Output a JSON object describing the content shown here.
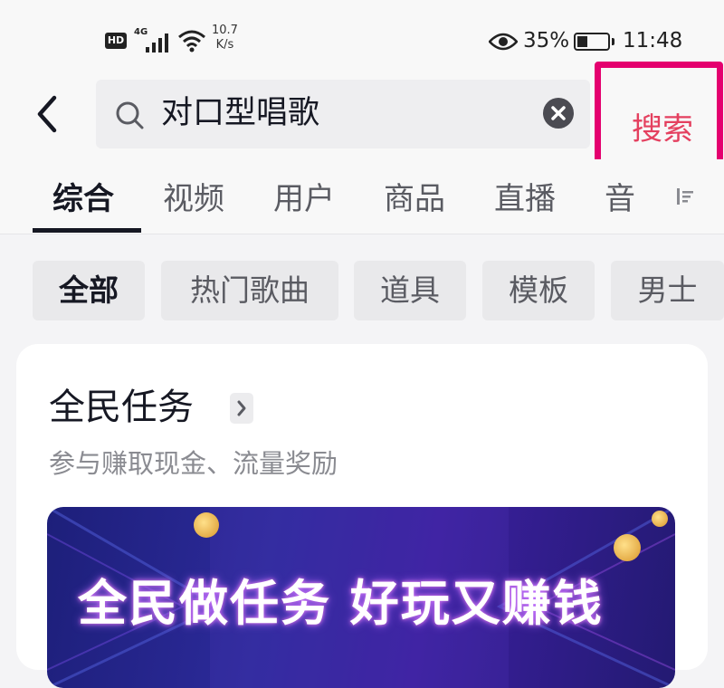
{
  "status_bar": {
    "hd": "HD",
    "network": "4G",
    "speed_value": "10.7",
    "speed_unit": "K/s",
    "battery": "35%",
    "battery_level": 0.35,
    "time": "11:48"
  },
  "search": {
    "query": "对口型唱歌",
    "action_label": "搜索"
  },
  "tabs": [
    {
      "label": "综合",
      "active": true
    },
    {
      "label": "视频",
      "active": false
    },
    {
      "label": "用户",
      "active": false
    },
    {
      "label": "商品",
      "active": false
    },
    {
      "label": "直播",
      "active": false
    },
    {
      "label": "音",
      "active": false
    }
  ],
  "chips": [
    {
      "label": "全部",
      "active": true
    },
    {
      "label": "热门歌曲",
      "active": false
    },
    {
      "label": "道具",
      "active": false
    },
    {
      "label": "模板",
      "active": false
    },
    {
      "label": "男士",
      "active": false
    }
  ],
  "card": {
    "title": "全民任务",
    "subtitle": "参与赚取现金、流量奖励",
    "banner_text": "全民做任务 好玩又赚钱"
  },
  "colors": {
    "accent": "#e4405f",
    "highlight_border": "#e4006f"
  }
}
